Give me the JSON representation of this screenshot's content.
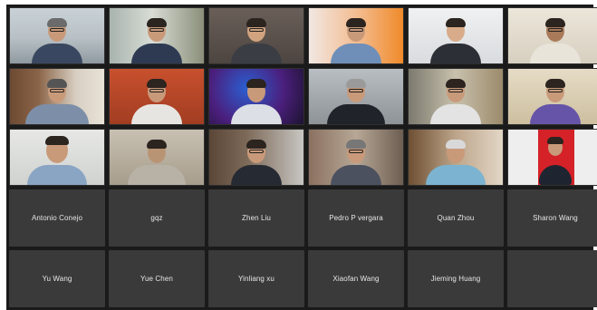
{
  "meeting": {
    "participants_with_video": [
      {
        "id": 1,
        "bg": "office"
      },
      {
        "id": 2,
        "bg": "window"
      },
      {
        "id": 3,
        "bg": "dark"
      },
      {
        "id": 4,
        "bg": "orange"
      },
      {
        "id": 5,
        "bg": "white"
      },
      {
        "id": 6,
        "bg": "cream"
      },
      {
        "id": 7,
        "bg": "shelf"
      },
      {
        "id": 8,
        "bg": "red"
      },
      {
        "id": 9,
        "bg": "purple"
      },
      {
        "id": 10,
        "bg": "gray"
      },
      {
        "id": 11,
        "bg": "room"
      },
      {
        "id": 12,
        "bg": "beige"
      },
      {
        "id": 13,
        "bg": "wall"
      },
      {
        "id": 14,
        "bg": "muted"
      },
      {
        "id": 15,
        "bg": "books"
      },
      {
        "id": 16,
        "bg": "home"
      },
      {
        "id": 17,
        "bg": "stone"
      },
      {
        "id": 18,
        "bg": "redpanel"
      }
    ],
    "participants_no_video": [
      {
        "name": "Antonio Conejo"
      },
      {
        "name": "gqz"
      },
      {
        "name": "Zhen Liu"
      },
      {
        "name": "Pedro P vergara"
      },
      {
        "name": "Quan Zhou"
      },
      {
        "name": "Sharon Wang"
      },
      {
        "name": "Yu Wang"
      },
      {
        "name": "Yue Chen"
      },
      {
        "name": "Yinliang xu"
      },
      {
        "name": "Xiaofan Wang"
      },
      {
        "name": "Jieming Huang"
      },
      {
        "name": ""
      }
    ]
  },
  "colors": {
    "frame": "#1a1a1a",
    "name_tile": "#3a3a3a",
    "name_text": "#e6e6e6"
  }
}
